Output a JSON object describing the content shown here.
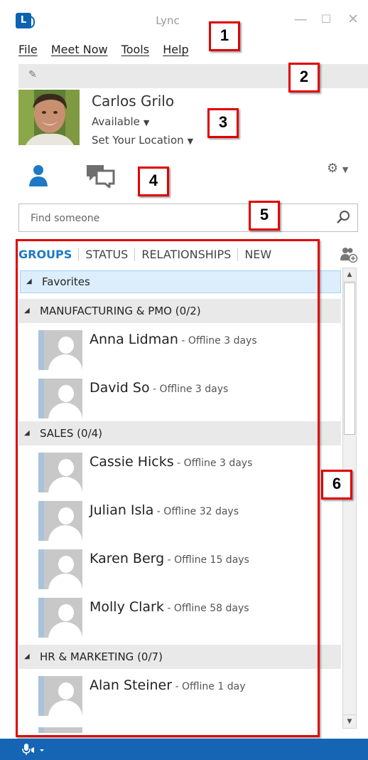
{
  "window": {
    "title": "Lync",
    "minimize": "—",
    "maximize": "☐",
    "close": "✕"
  },
  "menu": [
    "File",
    "Meet Now",
    "Tools",
    "Help"
  ],
  "note_icon": "note-icon",
  "profile": {
    "name": "Carlos Grilo",
    "presence": "Available",
    "location": "Set Your Location"
  },
  "search": {
    "placeholder": "Find someone"
  },
  "view_tabs": [
    "GROUPS",
    "STATUS",
    "RELATIONSHIPS",
    "NEW"
  ],
  "contacts": {
    "favorites": "Favorites",
    "groups": [
      {
        "name": "MANUFACTURING & PMO (0/2)",
        "members": [
          {
            "name": "Anna Lidman",
            "status": " - Offline 3 days"
          },
          {
            "name": "David So",
            "status": " - Offline 3 days"
          }
        ]
      },
      {
        "name": "SALES (0/4)",
        "members": [
          {
            "name": "Cassie Hicks",
            "status": " - Offline 3 days"
          },
          {
            "name": "Julian Isla",
            "status": " - Offline 32 days"
          },
          {
            "name": "Karen Berg",
            "status": " - Offline 15 days"
          },
          {
            "name": "Molly Clark",
            "status": " - Offline 58 days"
          }
        ]
      },
      {
        "name": "HR & MARKETING (0/7)",
        "members": [
          {
            "name": "Alan Steiner",
            "status": " - Offline 1 day"
          }
        ]
      }
    ]
  },
  "callouts": [
    "1",
    "2",
    "3",
    "4",
    "5",
    "6"
  ],
  "colors": {
    "accent": "#1d79c3",
    "status_bar": "#1565b4",
    "callout_border": "#e00000"
  }
}
